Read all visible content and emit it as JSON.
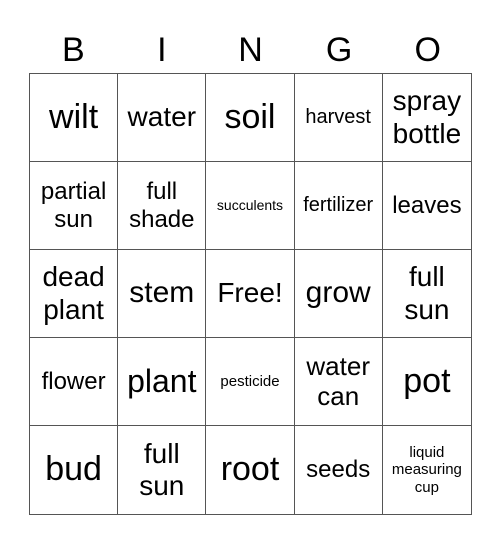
{
  "header": [
    "B",
    "I",
    "N",
    "G",
    "O"
  ],
  "cells": [
    {
      "text": "wilt",
      "size": "s34"
    },
    {
      "text": "water",
      "size": "s28"
    },
    {
      "text": "soil",
      "size": "s34"
    },
    {
      "text": "harvest",
      "size": "s20"
    },
    {
      "text": "spray bottle",
      "size": "s28"
    },
    {
      "text": "partial sun",
      "size": "s24"
    },
    {
      "text": "full shade",
      "size": "s24"
    },
    {
      "text": "succulents",
      "size": "s14"
    },
    {
      "text": "fertilizer",
      "size": "s20"
    },
    {
      "text": "leaves",
      "size": "s24"
    },
    {
      "text": "dead plant",
      "size": "s28"
    },
    {
      "text": "stem",
      "size": "s30"
    },
    {
      "text": "Free!",
      "size": "s28"
    },
    {
      "text": "grow",
      "size": "s30"
    },
    {
      "text": "full sun",
      "size": "s28"
    },
    {
      "text": "flower",
      "size": "s24"
    },
    {
      "text": "plant",
      "size": "s32"
    },
    {
      "text": "pesticide",
      "size": "s15"
    },
    {
      "text": "water can",
      "size": "s26"
    },
    {
      "text": "pot",
      "size": "s34"
    },
    {
      "text": "bud",
      "size": "s34"
    },
    {
      "text": "full sun",
      "size": "s28"
    },
    {
      "text": "root",
      "size": "s34"
    },
    {
      "text": "seeds",
      "size": "s24"
    },
    {
      "text": "liquid measuring cup",
      "size": "s15"
    }
  ]
}
